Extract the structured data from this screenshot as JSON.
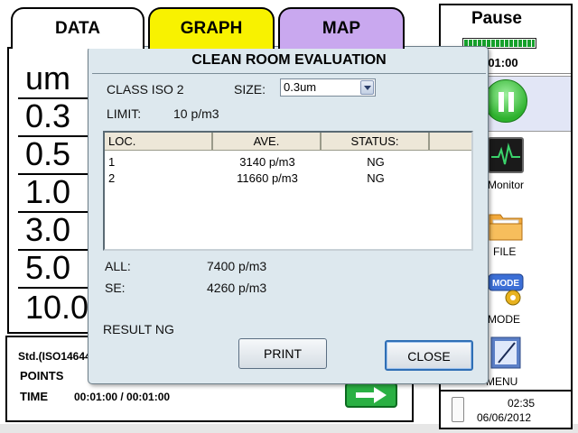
{
  "tabs": [
    {
      "label": "DATA",
      "active": true,
      "color": "#ffffff"
    },
    {
      "label": "GRAPH",
      "active": false,
      "color": "#f8f200"
    },
    {
      "label": "MAP",
      "active": false,
      "color": "#c9a8ef"
    }
  ],
  "measurements": [
    "um",
    "0.3",
    "0.5",
    "1.0",
    "3.0",
    "5.0",
    "10.0"
  ],
  "bottom_info": {
    "standard": "Std.(ISO14644",
    "points_label": "POINTS",
    "time_label": "TIME",
    "time_value": "00:01:00 / 00:01:00"
  },
  "sidebar": {
    "status_label": "Pause",
    "progress_percent": 100,
    "timer": ":01:00",
    "items": [
      {
        "label": "Monitor",
        "icon": "monitor-icon"
      },
      {
        "label": "FILE",
        "icon": "folder-icon"
      },
      {
        "label": "MODE",
        "icon": "mode-icon"
      },
      {
        "label": "MENU",
        "icon": "menu-icon"
      }
    ],
    "mode_icon_text": "MODE",
    "clock_time": "02:35",
    "clock_date": "06/06/2012"
  },
  "dialog": {
    "title": "CLEAN ROOM EVALUATION",
    "class_label": "CLASS ISO 2",
    "size_label": "SIZE:",
    "size_value": "0.3um",
    "limit_label": "LIMIT:",
    "limit_value": "10 p/m3",
    "table": {
      "columns": [
        "LOC.",
        "AVE.",
        "STATUS:",
        ""
      ],
      "rows": [
        {
          "loc": "1",
          "ave": "3140 p/m3",
          "status": "NG"
        },
        {
          "loc": "2",
          "ave": "11660 p/m3",
          "status": "NG"
        }
      ]
    },
    "all_label": "ALL:",
    "all_value": "7400 p/m3",
    "se_label": "SE:",
    "se_value": "4260 p/m3",
    "result": "RESULT NG",
    "print_label": "PRINT",
    "close_label": "CLOSE"
  },
  "colors": {
    "accent_green": "#2ab043",
    "dialog_bg": "#dde8ee",
    "close_focus": "#2f6fb5"
  }
}
